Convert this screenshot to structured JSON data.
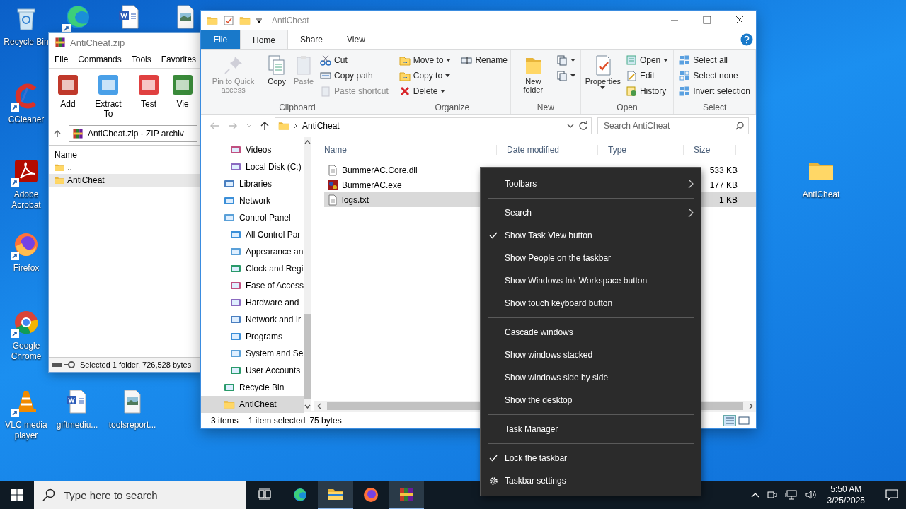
{
  "desktop_icons": [
    {
      "kind": "system",
      "label": "Recycle Bin"
    },
    {
      "kind": "shortcut"
    },
    {
      "kind": "file"
    },
    {
      "kind": "file"
    },
    {
      "kind": "shortcut",
      "label": "CCleaner"
    },
    {
      "kind": "shortcut",
      "label": "Adobe Acrobat"
    },
    {
      "kind": "shortcut",
      "label": "Firefox"
    },
    {
      "kind": "shortcut",
      "label": "Google Chrome"
    },
    {
      "kind": "shortcut",
      "label": "VLC media player"
    },
    {
      "kind": "file",
      "label": "giftmediu..."
    },
    {
      "kind": "file",
      "label": "toolsreport..."
    },
    {
      "kind": "folder",
      "label": "AntiCheat"
    }
  ],
  "winrar": {
    "title": "AntiCheat.zip",
    "menu": [
      "File",
      "Commands",
      "Tools",
      "Favorites"
    ],
    "toolbar": [
      "Add",
      "Extract To",
      "Test",
      "Vie"
    ],
    "address": "AntiCheat.zip - ZIP archiv",
    "columns": [
      "Name"
    ],
    "rows": [
      {
        "name": "..",
        "selected": false
      },
      {
        "name": "AntiCheat",
        "selected": true
      }
    ],
    "status": "Selected 1 folder, 726,528 bytes"
  },
  "explorer": {
    "title": "AntiCheat",
    "tabs": [
      {
        "label": "File",
        "kind": "file",
        "selected": false
      },
      {
        "label": "Home",
        "kind": "tab",
        "selected": true
      },
      {
        "label": "Share",
        "kind": "tab",
        "selected": false
      },
      {
        "label": "View",
        "kind": "tab",
        "selected": false
      }
    ],
    "ribbon": [
      {
        "label": "Clipboard",
        "large": [
          {
            "label": "Pin to Quick access",
            "disabled": true,
            "dropdown": false
          },
          {
            "label": "Copy",
            "disabled": false,
            "dropdown": false
          },
          {
            "label": "Paste",
            "disabled": true,
            "dropdown": false
          }
        ],
        "small": [
          {
            "label": "Cut",
            "disabled": false,
            "dropdown": false
          },
          {
            "label": "Copy path",
            "disabled": false,
            "dropdown": false
          },
          {
            "label": "Paste shortcut",
            "disabled": true,
            "dropdown": false
          }
        ]
      },
      {
        "label": "Organize",
        "small": [
          {
            "label": "Move to",
            "disabled": false,
            "dropdown": true
          },
          {
            "label": "Copy to",
            "disabled": false,
            "dropdown": true
          },
          {
            "label": "Delete",
            "disabled": false,
            "dropdown": true
          },
          {
            "label": "Rename",
            "disabled": false,
            "dropdown": false
          }
        ]
      },
      {
        "label": "New",
        "large": [
          {
            "label": "New folder",
            "disabled": false,
            "dropdown": false
          }
        ],
        "small": [
          {
            "disabled": false,
            "dropdown": true
          },
          {
            "disabled": false,
            "dropdown": true
          }
        ]
      },
      {
        "label": "Open",
        "large": [
          {
            "label": "Properties",
            "disabled": false,
            "dropdown": true
          }
        ],
        "small": [
          {
            "label": "Open",
            "disabled": false,
            "dropdown": true
          },
          {
            "label": "Edit",
            "disabled": false,
            "dropdown": false
          },
          {
            "label": "History",
            "disabled": false,
            "dropdown": false
          }
        ]
      },
      {
        "label": "Select",
        "small": [
          {
            "label": "Select all",
            "disabled": false,
            "dropdown": false
          },
          {
            "label": "Select none",
            "disabled": false,
            "dropdown": false
          },
          {
            "label": "Invert selection",
            "disabled": false,
            "dropdown": false
          }
        ]
      }
    ],
    "address": "AntiCheat",
    "search": {
      "placeholder": "Search AntiCheat"
    },
    "nav": {
      "continued": [
        {
          "label": "Videos",
          "selected": false
        },
        {
          "label": "Local Disk (C:)",
          "selected": false
        }
      ],
      "items": [
        {
          "label": "Libraries",
          "selected": false
        },
        {
          "label": "Network",
          "selected": false
        },
        {
          "label": "Control Panel",
          "selected": false,
          "children": [
            {
              "label": "All Control Par",
              "selected": false
            },
            {
              "label": "Appearance an",
              "selected": false
            },
            {
              "label": "Clock and Regi",
              "selected": false
            },
            {
              "label": "Ease of Access",
              "selected": false
            },
            {
              "label": "Hardware and",
              "selected": false
            },
            {
              "label": "Network and Ir",
              "selected": false
            },
            {
              "label": "Programs",
              "selected": false
            },
            {
              "label": "System and Se",
              "selected": false
            },
            {
              "label": "User Accounts",
              "selected": false
            }
          ]
        },
        {
          "label": "Recycle Bin",
          "selected": false
        },
        {
          "label": "AntiCheat",
          "selected": true
        }
      ]
    },
    "columns": [
      "Name",
      "Date modified",
      "Type",
      "Size"
    ],
    "files": [
      {
        "name": "BummerAC.Core.dll",
        "size": "533 KB",
        "selected": false
      },
      {
        "name": "BummerAC.exe",
        "size": "177 KB",
        "selected": false
      },
      {
        "name": "logs.txt",
        "size": "1 KB",
        "selected": true
      }
    ],
    "status": {
      "count": "3 items",
      "selection": "1 item selected",
      "size": "75 bytes"
    }
  },
  "context_menu": [
    {
      "kind": "item",
      "label": "Toolbars",
      "checked": false,
      "submenu": true
    },
    {
      "kind": "separator"
    },
    {
      "kind": "item",
      "label": "Search",
      "checked": false,
      "submenu": true
    },
    {
      "kind": "item",
      "label": "Show Task View button",
      "checked": true,
      "submenu": false
    },
    {
      "kind": "item",
      "label": "Show People on the taskbar",
      "checked": false,
      "submenu": false
    },
    {
      "kind": "item",
      "label": "Show Windows Ink Workspace button",
      "checked": false,
      "submenu": false
    },
    {
      "kind": "item",
      "label": "Show touch keyboard button",
      "checked": false,
      "submenu": false
    },
    {
      "kind": "separator"
    },
    {
      "kind": "item",
      "label": "Cascade windows",
      "checked": false,
      "submenu": false
    },
    {
      "kind": "item",
      "label": "Show windows stacked",
      "checked": false,
      "submenu": false
    },
    {
      "kind": "item",
      "label": "Show windows side by side",
      "checked": false,
      "submenu": false
    },
    {
      "kind": "item",
      "label": "Show the desktop",
      "checked": false,
      "submenu": false
    },
    {
      "kind": "separator"
    },
    {
      "kind": "item",
      "label": "Task Manager",
      "checked": false,
      "submenu": false
    },
    {
      "kind": "separator"
    },
    {
      "kind": "item",
      "label": "Lock the taskbar",
      "checked": true,
      "submenu": false
    },
    {
      "kind": "settings",
      "label": "Taskbar settings",
      "checked": false,
      "submenu": false
    }
  ],
  "taskbar": {
    "search": {
      "placeholder": "Type here to search"
    },
    "apps": [
      {
        "active": false
      },
      {
        "active": false
      },
      {
        "active": true
      },
      {
        "active": false
      },
      {
        "active": true
      }
    ],
    "time": "5:50 AM",
    "date": "3/25/2025"
  }
}
